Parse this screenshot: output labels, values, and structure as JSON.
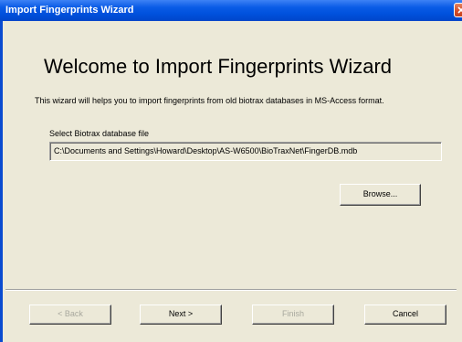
{
  "window": {
    "title": "Import Fingerprints Wizard",
    "close_icon": "close-icon"
  },
  "page": {
    "heading": "Welcome to Import Fingerprints Wizard",
    "intro": "This wizard will helps you to import fingerprints from old biotrax databases in MS-Access format.",
    "field_label": "Select Biotrax database file",
    "field_value": "C:\\Documents and Settings\\Howard\\Desktop\\AS-W6500\\BioTraxNet\\FingerDB.mdb"
  },
  "buttons": {
    "browse": "Browse...",
    "back": "< Back",
    "next": "Next >",
    "finish": "Finish",
    "cancel": "Cancel"
  },
  "colors": {
    "titlebar": "#0a5ce6",
    "face": "#ece9d8",
    "disabled_text": "#a8a89e"
  }
}
